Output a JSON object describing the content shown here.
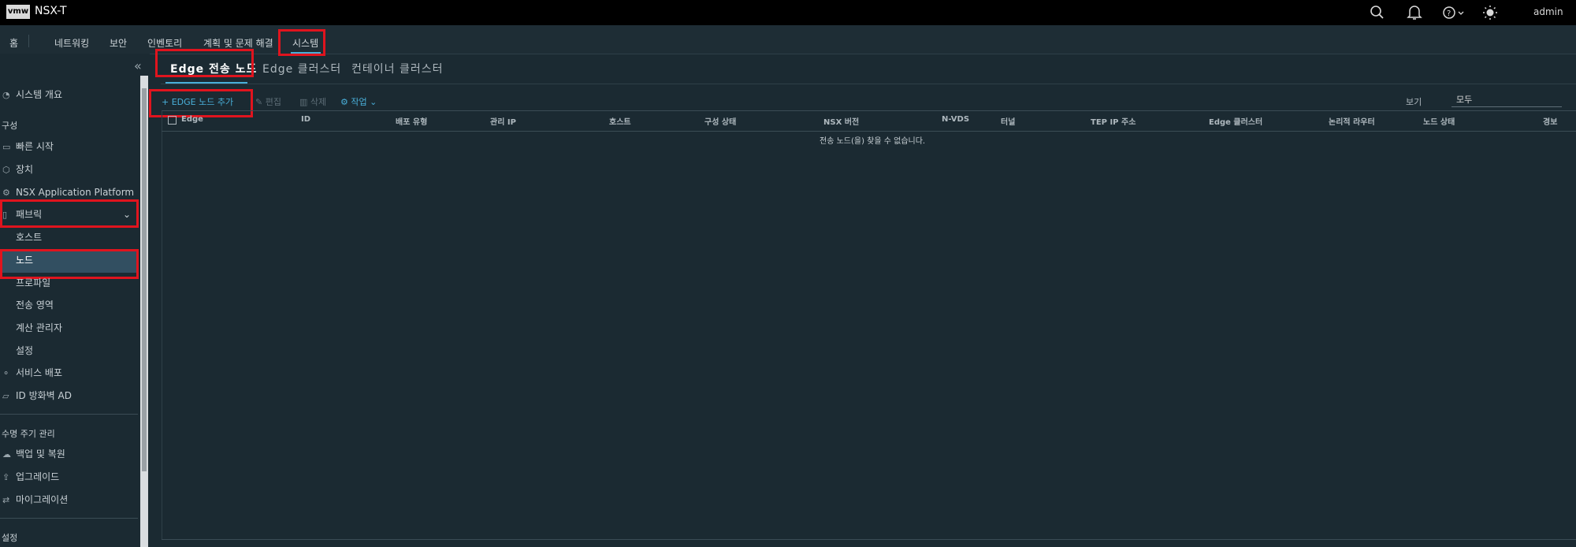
{
  "topbar": {
    "logo": "vmw",
    "title": "NSX-T",
    "user": "admin"
  },
  "nav": {
    "items": [
      "홈",
      "네트워킹",
      "보안",
      "인벤토리",
      "계획 및 문제 해결",
      "시스템"
    ],
    "active": "시스템"
  },
  "sidebar": {
    "collapse_glyph": "«",
    "overview": "시스템 개요",
    "section_config": "구성",
    "items": [
      "빠른 시작",
      "장치",
      "NSX Application Platform",
      "패브릭"
    ],
    "fabric_children": [
      "호스트",
      "노드",
      "프로파일",
      "전송 영역",
      "계산 관리자",
      "설정"
    ],
    "items_after": [
      "서비스 배포",
      "ID 방화벽 AD"
    ],
    "section_lifecycle": "수명 주기 관리",
    "lifecycle_items": [
      "백업 및 복원",
      "업그레이드",
      "마이그레이션"
    ],
    "section_settings": "설정"
  },
  "tabs": [
    "Edge 전송 노드",
    "Edge 클러스터",
    "컨테이너 클러스터"
  ],
  "toolbar": {
    "add": "+ EDGE 노드 추가",
    "edit": "편집",
    "delete": "삭제",
    "actions": "작업",
    "view_label": "보기",
    "view_value": "모두"
  },
  "table": {
    "columns": [
      "Edge",
      "ID",
      "배포 유형",
      "관리 IP",
      "호스트",
      "구성 상태",
      "NSX 버전",
      "N-VDS",
      "터널",
      "TEP IP 주소",
      "Edge 클러스터",
      "논리적 라우터",
      "노드 상태",
      "경보"
    ],
    "empty_message": "전송 노드(을) 찾을 수 없습니다."
  },
  "colors": {
    "accent": "#49afd9",
    "highlight_box": "#e0141e",
    "background": "#1b2a32"
  }
}
